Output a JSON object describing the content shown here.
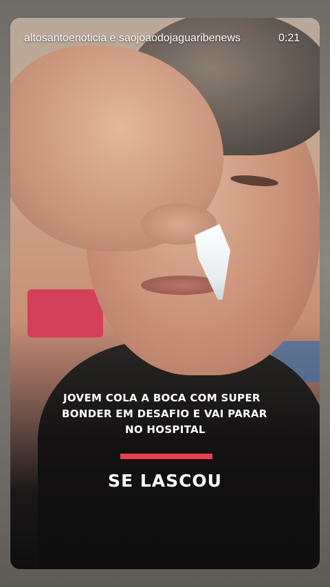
{
  "story": {
    "username": "altosantoenoticia e saojoaodojaguaribenews",
    "timestamp": "0:21"
  },
  "overlay": {
    "headline_lines": [
      "JOVEM COLA A BOCA COM SUPER",
      "BONDER EM DESAFIO E VAI PARAR",
      "NO HOSPITAL"
    ],
    "tagline": "SE LASCOU",
    "accent_color": "#e8414b"
  }
}
